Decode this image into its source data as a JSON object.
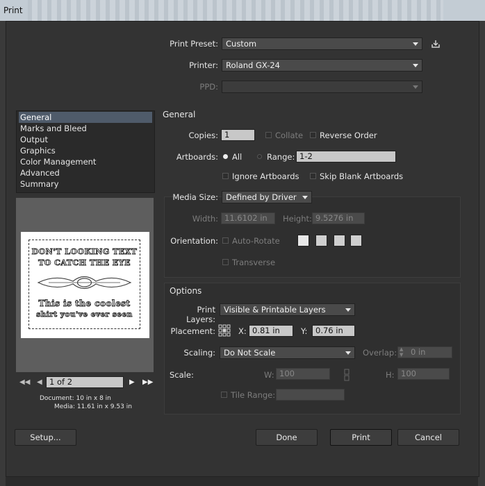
{
  "window": {
    "title": "Print"
  },
  "preset": {
    "label": "Print Preset:",
    "value": "Custom"
  },
  "printer": {
    "label": "Printer:",
    "value": "Roland GX-24"
  },
  "ppd": {
    "label": "PPD:",
    "value": ""
  },
  "sidebar": {
    "items": [
      {
        "label": "General",
        "selected": true
      },
      {
        "label": "Marks and Bleed"
      },
      {
        "label": "Output"
      },
      {
        "label": "Graphics"
      },
      {
        "label": "Color Management"
      },
      {
        "label": "Advanced"
      },
      {
        "label": "Summary"
      }
    ]
  },
  "general": {
    "heading": "General",
    "copies_label": "Copies:",
    "copies_value": "1",
    "collate": "Collate",
    "reverse_order": "Reverse Order",
    "artboards_label": "Artboards:",
    "all": "All",
    "range_label": "Range:",
    "range_value": "1-2",
    "ignore_artboards": "Ignore Artboards",
    "skip_blank": "Skip Blank Artboards"
  },
  "media": {
    "size_label": "Media Size:",
    "size_value": "Defined by Driver",
    "width_label": "Width:",
    "width_value": "11.6102 in",
    "height_label": "Height:",
    "height_value": "9.5276 in",
    "orientation_label": "Orientation:",
    "auto_rotate": "Auto-Rotate",
    "transverse": "Transverse"
  },
  "options": {
    "heading": "Options",
    "print_layers_label": "Print Layers:",
    "print_layers_value": "Visible & Printable Layers",
    "placement_label": "Placement:",
    "x_label": "X:",
    "x_value": "0.81 in",
    "y_label": "Y:",
    "y_value": "0.76 in",
    "scaling_label": "Scaling:",
    "scaling_value": "Do Not Scale",
    "overlap_label": "Overlap:",
    "overlap_value": "0 in",
    "scale_label": "Scale:",
    "w_label": "W:",
    "w_value": "100",
    "h_label": "H:",
    "h_value": "100",
    "tile_range_label": "Tile Range:",
    "tile_range_value": ""
  },
  "preview": {
    "line1": "DON'T LOOKING TEXT",
    "line2": "TO CATCH THE EYE",
    "line3": "This is the coolest",
    "line4": "shirt you've ever seen",
    "page": "1 of 2",
    "document_info": "Document: 10 in x 8 in",
    "media_info": "Media: 11.61 in x 9.53 in"
  },
  "buttons": {
    "setup": "Setup...",
    "done": "Done",
    "print": "Print",
    "cancel": "Cancel"
  },
  "icons": {
    "save_preset": "save-preset-icon"
  }
}
